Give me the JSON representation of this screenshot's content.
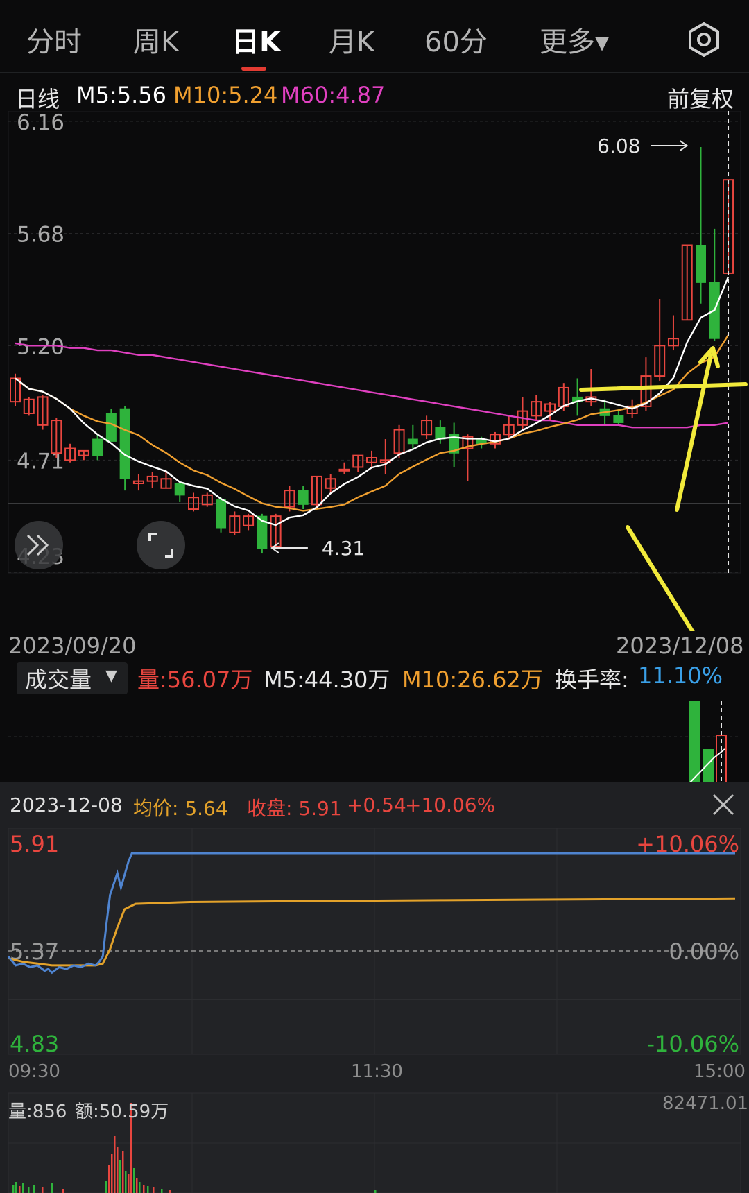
{
  "tabs": [
    {
      "label": "分时",
      "active": false
    },
    {
      "label": "周K",
      "active": false
    },
    {
      "label": "日K",
      "active": true
    },
    {
      "label": "月K",
      "active": false
    },
    {
      "label": "60分",
      "active": false
    },
    {
      "label": "更多▾",
      "active": false
    }
  ],
  "settings_icon": "gear-icon",
  "ma_header": {
    "period": "日线",
    "m5": "M5:5.56",
    "m10": "M10:5.24",
    "m60": "M60:4.87",
    "adjust": "前复权"
  },
  "colors": {
    "up": "#e8463f",
    "down": "#2fb33c",
    "m5": "#ffffff",
    "m10": "#f0a030",
    "m60": "#e040c0",
    "annotation": "#f2ea3b",
    "intraday_price": "#4f84d0",
    "intraday_avg": "#e3a22a"
  },
  "kline": {
    "y_axis": [
      "6.16",
      "5.68",
      "5.20",
      "4.71",
      "4.23"
    ],
    "high_label": "6.08",
    "low_label": "4.31",
    "start_date": "2023/09/20",
    "end_date": "2023/12/08",
    "candles": [
      [
        4.96,
        5.06,
        4.94,
        5.08
      ],
      [
        4.91,
        4.97,
        4.9,
        4.98
      ],
      [
        4.86,
        4.98,
        4.84,
        4.99
      ],
      [
        4.74,
        4.88,
        4.72,
        4.89
      ],
      [
        4.71,
        4.76,
        4.7,
        4.78
      ],
      [
        4.73,
        4.75,
        4.71,
        4.75
      ],
      [
        4.8,
        4.73,
        4.71,
        4.82
      ],
      [
        4.91,
        4.79,
        4.79,
        4.93
      ],
      [
        4.93,
        4.63,
        4.58,
        4.94
      ],
      [
        4.61,
        4.62,
        4.58,
        4.65
      ],
      [
        4.62,
        4.64,
        4.59,
        4.66
      ],
      [
        4.59,
        4.63,
        4.59,
        4.66
      ],
      [
        4.61,
        4.56,
        4.53,
        4.61
      ],
      [
        4.5,
        4.55,
        4.49,
        4.57
      ],
      [
        4.52,
        4.56,
        4.51,
        4.57
      ],
      [
        4.54,
        4.42,
        4.4,
        4.55
      ],
      [
        4.4,
        4.47,
        4.39,
        4.49
      ],
      [
        4.43,
        4.47,
        4.41,
        4.48
      ],
      [
        4.47,
        4.33,
        4.31,
        4.48
      ],
      [
        4.34,
        4.47,
        4.33,
        4.48
      ],
      [
        4.51,
        4.58,
        4.49,
        4.6
      ],
      [
        4.58,
        4.52,
        4.5,
        4.6
      ],
      [
        4.52,
        4.64,
        4.5,
        4.64
      ],
      [
        4.59,
        4.63,
        4.57,
        4.65
      ],
      [
        4.67,
        4.67,
        4.65,
        4.7
      ],
      [
        4.68,
        4.73,
        4.66,
        4.73
      ],
      [
        4.7,
        4.72,
        4.68,
        4.75
      ],
      [
        4.7,
        4.71,
        4.65,
        4.8
      ],
      [
        4.74,
        4.84,
        4.72,
        4.86
      ],
      [
        4.8,
        4.78,
        4.76,
        4.86
      ],
      [
        4.82,
        4.88,
        4.8,
        4.9
      ],
      [
        4.85,
        4.8,
        4.78,
        4.88
      ],
      [
        4.82,
        4.74,
        4.68,
        4.87
      ],
      [
        4.76,
        4.81,
        4.62,
        4.82
      ],
      [
        4.8,
        4.78,
        4.76,
        4.81
      ],
      [
        4.78,
        4.82,
        4.76,
        4.83
      ],
      [
        4.82,
        4.86,
        4.8,
        4.9
      ],
      [
        4.86,
        4.92,
        4.84,
        4.98
      ],
      [
        4.9,
        4.96,
        4.88,
        4.99
      ],
      [
        4.92,
        4.95,
        4.88,
        4.96
      ],
      [
        4.94,
        5.02,
        4.92,
        5.04
      ],
      [
        4.98,
        4.96,
        4.9,
        5.06
      ],
      [
        4.96,
        4.98,
        4.94,
        5.1
      ],
      [
        4.93,
        4.9,
        4.86,
        4.97
      ],
      [
        4.9,
        4.87,
        4.86,
        4.93
      ],
      [
        4.91,
        4.94,
        4.89,
        4.97
      ],
      [
        4.94,
        5.07,
        4.92,
        5.15
      ],
      [
        5.07,
        5.2,
        5.05,
        5.4
      ],
      [
        5.2,
        5.23,
        5.18,
        5.33
      ],
      [
        5.31,
        5.63,
        5.31,
        5.63
      ],
      [
        5.63,
        5.47,
        5.38,
        6.05
      ],
      [
        5.47,
        5.23,
        5.22,
        5.7
      ],
      [
        5.51,
        5.91,
        5.51,
        5.91
      ]
    ],
    "ma60": [
      5.21,
      5.2,
      5.2,
      5.2,
      5.19,
      5.19,
      5.18,
      5.18,
      5.17,
      5.16,
      5.16,
      5.15,
      5.14,
      5.13,
      5.12,
      5.11,
      5.1,
      5.09,
      5.08,
      5.07,
      5.06,
      5.05,
      5.04,
      5.03,
      5.02,
      5.01,
      5.0,
      4.99,
      4.98,
      4.97,
      4.96,
      4.95,
      4.94,
      4.93,
      4.92,
      4.91,
      4.9,
      4.89,
      4.88,
      4.88,
      4.87,
      4.86,
      4.86,
      4.86,
      4.86,
      4.85,
      4.85,
      4.85,
      4.85,
      4.85,
      4.86,
      4.86,
      4.87
    ]
  },
  "volume_header": {
    "selector": "成交量",
    "vol": "量:56.07万",
    "m5": "M5:44.30万",
    "m10": "M10:26.62万",
    "turnover_label": "换手率:",
    "turnover_value": "11.10%"
  },
  "intraday": {
    "date": "2023-12-08",
    "avg": "均价: 5.64",
    "close": "收盘: 5.91",
    "change": "+0.54",
    "pct": "+10.06%",
    "price_high": "5.91",
    "price_mid": "5.37",
    "price_low": "4.83",
    "pct_high": "+10.06%",
    "pct_mid": "0.00%",
    "pct_low": "-10.06%",
    "times": [
      "09:30",
      "11:30",
      "15:00"
    ],
    "volume_label": "量:856",
    "amount_label": "额:50.59万",
    "vol_max": "82471.01"
  }
}
